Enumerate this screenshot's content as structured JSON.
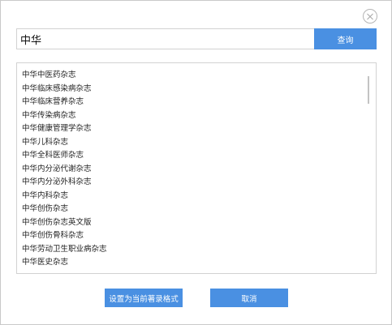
{
  "search": {
    "value": "中华",
    "button_label": "查询"
  },
  "results": [
    "中华中医药杂志",
    "中华临床感染病杂志",
    "中华临床营养杂志",
    "中华传染病杂志",
    "中华健康管理学杂志",
    "中华儿科杂志",
    "中华全科医师杂志",
    "中华内分泌代谢杂志",
    "中华内分泌外科杂志",
    "中华内科杂志",
    "中华创伤杂志",
    "中华创伤杂志英文版",
    "中华创伤骨科杂志",
    "中华劳动卫生职业病杂志",
    "中华医史杂志"
  ],
  "footer": {
    "set_format_label": "设置为当前著录格式",
    "cancel_label": "取消"
  },
  "colors": {
    "accent": "#4a90e2",
    "border": "#d2d2d2"
  },
  "icons": {
    "close": "close-icon"
  }
}
